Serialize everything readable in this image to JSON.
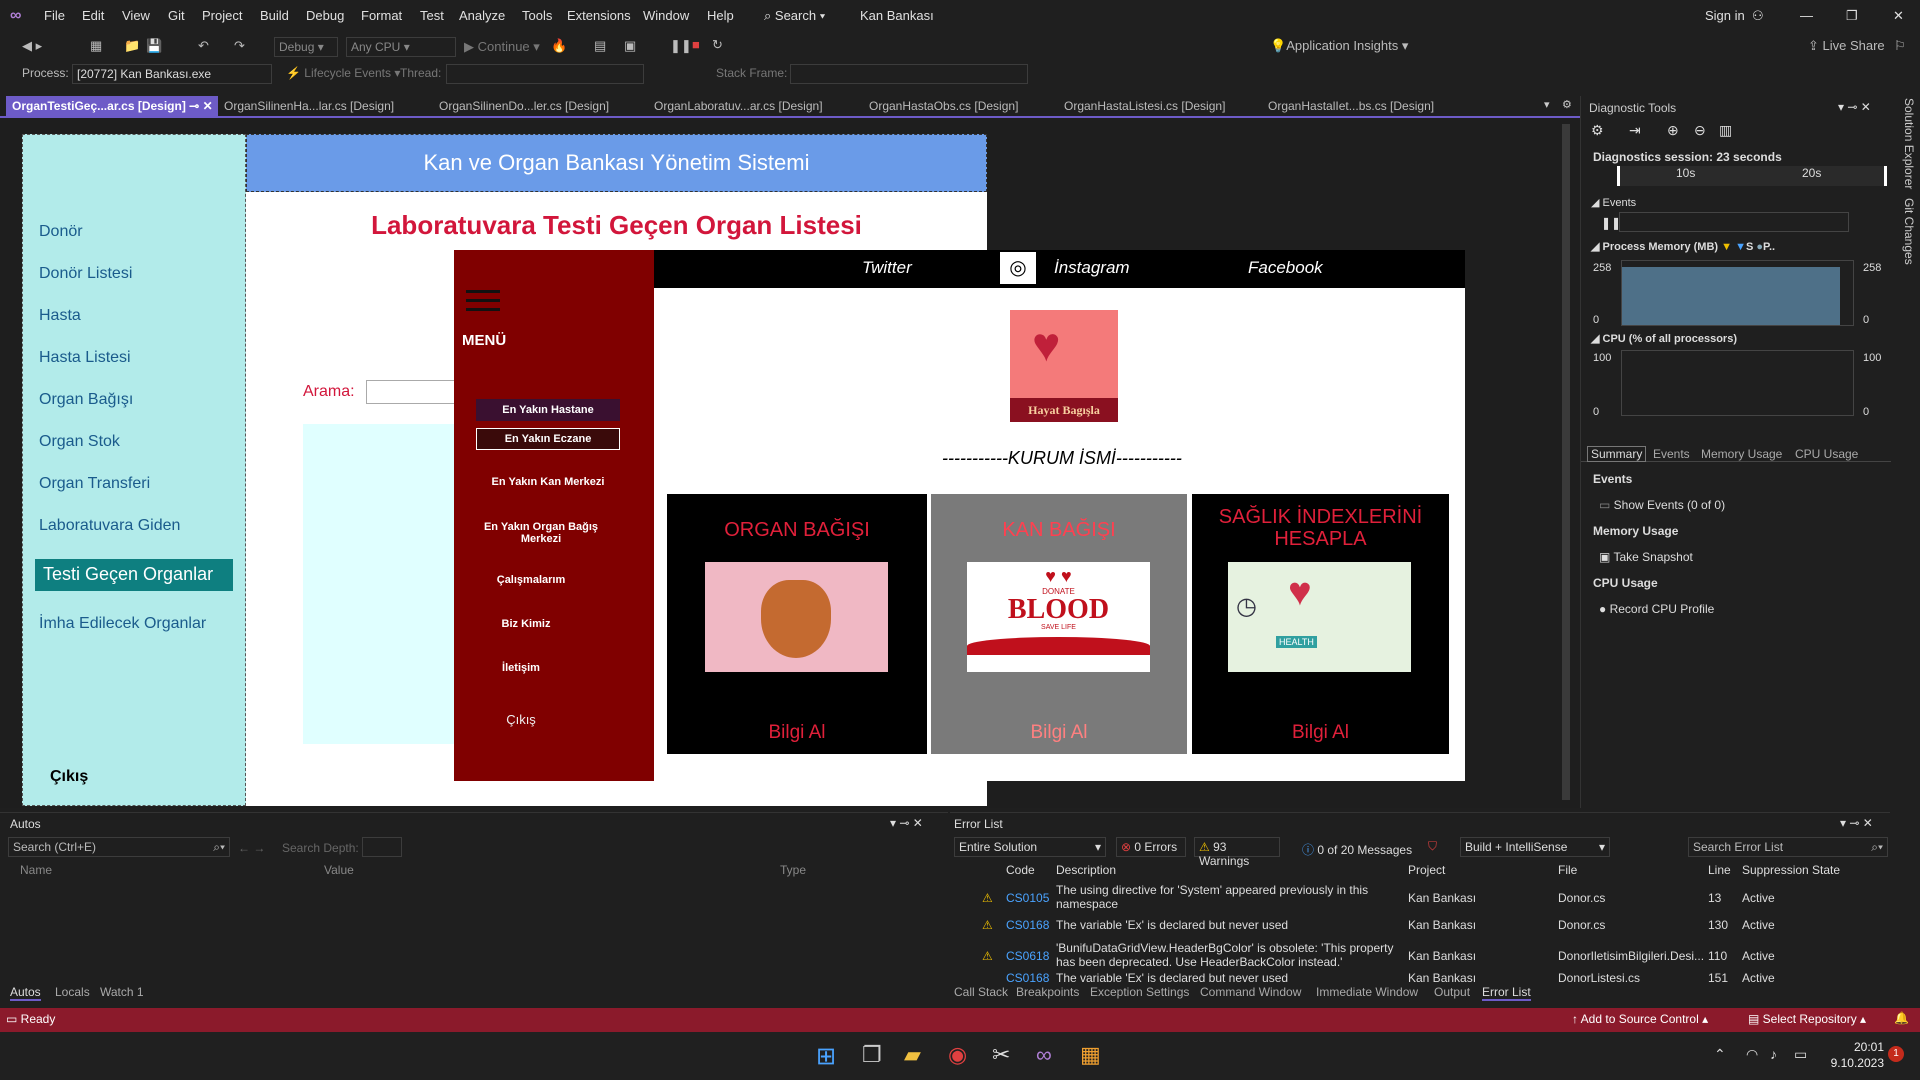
{
  "menubar": {
    "items": [
      "File",
      "Edit",
      "View",
      "Git",
      "Project",
      "Build",
      "Debug",
      "Format",
      "Test",
      "Analyze",
      "Tools",
      "Extensions",
      "Window",
      "Help"
    ],
    "search": "Search",
    "project_name": "Kan Bankası",
    "sign_in": "Sign in"
  },
  "toolbar": {
    "config": "Debug",
    "platform": "Any CPU",
    "continue": "Continue",
    "app_insights": "Application Insights",
    "live_share": "Live Share"
  },
  "procbar": {
    "process_label": "Process:",
    "process_value": "[20772] Kan Bankası.exe",
    "lifecycle": "Lifecycle Events",
    "thread_label": "Thread:",
    "stack_label": "Stack Frame:"
  },
  "tabs": [
    "OrganTestiGeç...ar.cs [Design]",
    "OrganSilinenHa...lar.cs [Design]",
    "OrganSilinenDo...ler.cs [Design]",
    "OrganLaboratuv...ar.cs [Design]",
    "OrganHastaObs.cs [Design]",
    "OrganHastaListesi.cs [Design]",
    "OrganHastalIet...bs.cs [Design]"
  ],
  "form": {
    "header": "Kan ve Organ Bankası Yönetim Sistemi",
    "title": "Laboratuvara Testi Geçen  Organ Listesi",
    "search_label": "Arama:",
    "sidebar": [
      "Donör",
      "Donör Listesi",
      "Hasta",
      "Hasta Listesi",
      "Organ Bağışı",
      "Organ Stok",
      "Organ Transferi",
      "Laboratuvara Giden",
      "Testi Geçen Organlar",
      "İmha Edilecek Organlar"
    ],
    "exit": "Çıkış"
  },
  "overlay": {
    "menu_title": "MENÜ",
    "menu_items": [
      "En Yakın Hastane",
      "En Yakın Eczane",
      "En Yakın Kan Merkezi",
      "En Yakın Organ Bağış Merkezi",
      "Çalışmalarım",
      "Biz Kimiz",
      "İletişim",
      "Çıkış"
    ],
    "links": [
      "Twitter",
      "İnstagram",
      "Facebook"
    ],
    "logo_text": "Hayat Bagışla",
    "institution": "-----------KURUM İSMİ-----------",
    "cards": [
      {
        "title": "ORGAN BAĞIŞI",
        "button": "Bilgi Al"
      },
      {
        "title": "KAN BAĞIŞI",
        "button": "Bilgi Al"
      },
      {
        "title": "SAĞLIK İNDEXLERİNİ HESAPLA",
        "button": "Bilgi Al"
      }
    ],
    "blood_text": "BLOOD",
    "donate_text": "DONATE",
    "save_life": "SAVE LIFE",
    "health_text": "HEALTH"
  },
  "diagnostics": {
    "title": "Diagnostic Tools",
    "session": "Diagnostics session: 23 seconds",
    "t10": "10s",
    "t20": "20s",
    "events": "Events",
    "memory_title": "Process Memory (MB)",
    "mem_legend_s": "S",
    "mem_legend_p": "P..",
    "mem_max": "258",
    "mem_min": "0",
    "cpu_title": "CPU (% of all processors)",
    "cpu_max": "100",
    "cpu_min": "0",
    "tabs": [
      "Summary",
      "Events",
      "Memory Usage",
      "CPU Usage"
    ],
    "sec_events": "Events",
    "show_events": "Show Events (0 of 0)",
    "sec_memory": "Memory Usage",
    "take_snapshot": "Take Snapshot",
    "sec_cpu": "CPU Usage",
    "record_cpu": "Record CPU Profile",
    "side_tabs": [
      "Solution Explorer",
      "Git Changes"
    ]
  },
  "autos": {
    "title": "Autos",
    "search": "Search (Ctrl+E)",
    "depth": "Search Depth:",
    "cols": [
      "Name",
      "Value",
      "Type"
    ],
    "tabs": [
      "Autos",
      "Locals",
      "Watch 1"
    ]
  },
  "errors": {
    "title": "Error List",
    "scope": "Entire Solution",
    "errors": "0 Errors",
    "warnings": "93 Warnings",
    "messages": "0 of 20 Messages",
    "build": "Build + IntelliSense",
    "search": "Search Error List",
    "cols": [
      "Code",
      "Description",
      "Project",
      "File",
      "Line",
      "Suppression State"
    ],
    "rows": [
      {
        "code": "CS0105",
        "desc": "The using directive for 'System' appeared previously in this namespace",
        "project": "Kan Bankası",
        "file": "Donor.cs",
        "line": "13",
        "state": "Active"
      },
      {
        "code": "CS0168",
        "desc": "The variable 'Ex' is declared but never used",
        "project": "Kan Bankası",
        "file": "Donor.cs",
        "line": "130",
        "state": "Active"
      },
      {
        "code": "CS0618",
        "desc": "'BunifuDataGridView.HeaderBgColor' is obsolete: 'This property has been deprecated. Use HeaderBackColor instead.'",
        "project": "Kan Bankası",
        "file": "DonorIletisimBilgileri.Desi...",
        "line": "110",
        "state": "Active"
      },
      {
        "code": "CS0168",
        "desc": "The variable 'Ex' is declared but never used",
        "project": "Kan Bankası",
        "file": "DonorListesi.cs",
        "line": "151",
        "state": "Active"
      }
    ],
    "tabs": [
      "Call Stack",
      "Breakpoints",
      "Exception Settings",
      "Command Window",
      "Immediate Window",
      "Output",
      "Error List"
    ]
  },
  "status": {
    "ready": "Ready",
    "source_control": "Add to Source Control",
    "repo": "Select Repository"
  },
  "taskbar": {
    "time": "20:01",
    "date": "9.10.2023",
    "badge": "1"
  },
  "colors": {
    "accent": "#6d5bc7",
    "status": "#8b1a2b",
    "menu_red": "#800000"
  }
}
